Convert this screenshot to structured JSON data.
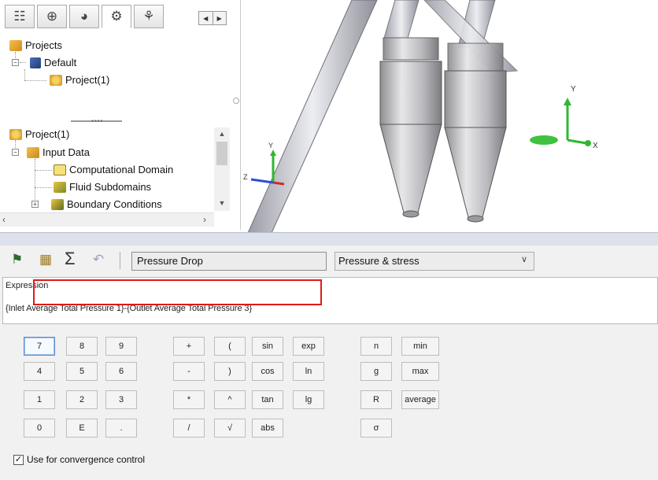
{
  "manager": {
    "tabs": [
      {
        "icon": "feature-manager-icon",
        "glyph": "☷"
      },
      {
        "icon": "property-manager-icon",
        "glyph": "⊕"
      },
      {
        "icon": "appearance-icon",
        "glyph": "◕"
      },
      {
        "icon": "flow-simulation-icon",
        "glyph": "⚙"
      },
      {
        "icon": "flow-tree-icon",
        "glyph": "⚘"
      }
    ],
    "projects_tree": {
      "root": "Projects",
      "config": "Default",
      "project": "Project(1)"
    },
    "analysis_tree": {
      "project": "Project(1)",
      "input_data": "Input Data",
      "items": [
        "Computational Domain",
        "Fluid Subdomains",
        "Boundary Conditions"
      ]
    }
  },
  "calculator": {
    "parameter_name": "Pressure Drop",
    "category": "Pressure & stress",
    "expression_label": "Expression",
    "expression": "{Inlet Average Total Pressure 1}-{Outlet Average Total Pressure 3}",
    "keys": {
      "digits": [
        [
          "7",
          "8",
          "9"
        ],
        [
          "4",
          "5",
          "6"
        ],
        [
          "1",
          "2",
          "3"
        ],
        [
          "0",
          "E",
          "."
        ]
      ],
      "ops": [
        [
          "+",
          "("
        ],
        [
          "-",
          ")"
        ],
        [
          "*",
          "^"
        ],
        [
          "/",
          "√"
        ]
      ],
      "funcs": [
        [
          "sin",
          "exp"
        ],
        [
          "cos",
          "ln"
        ],
        [
          "tan",
          "lg"
        ],
        [
          "abs"
        ]
      ],
      "consts": [
        [
          "n",
          "min"
        ],
        [
          "g",
          "max"
        ],
        [
          "R",
          "average"
        ],
        [
          "σ"
        ]
      ]
    },
    "convergence_label": "Use for convergence control",
    "convergence_checked": true
  },
  "viewport": {
    "axis_labels": {
      "x": "X",
      "y": "Y",
      "z": "Z"
    }
  },
  "colors": {
    "highlight": "#e11919",
    "axis_x": "#d22a2a",
    "axis_y": "#2fb82f",
    "axis_z": "#2d4fd6",
    "model": "#c9c9cc"
  }
}
